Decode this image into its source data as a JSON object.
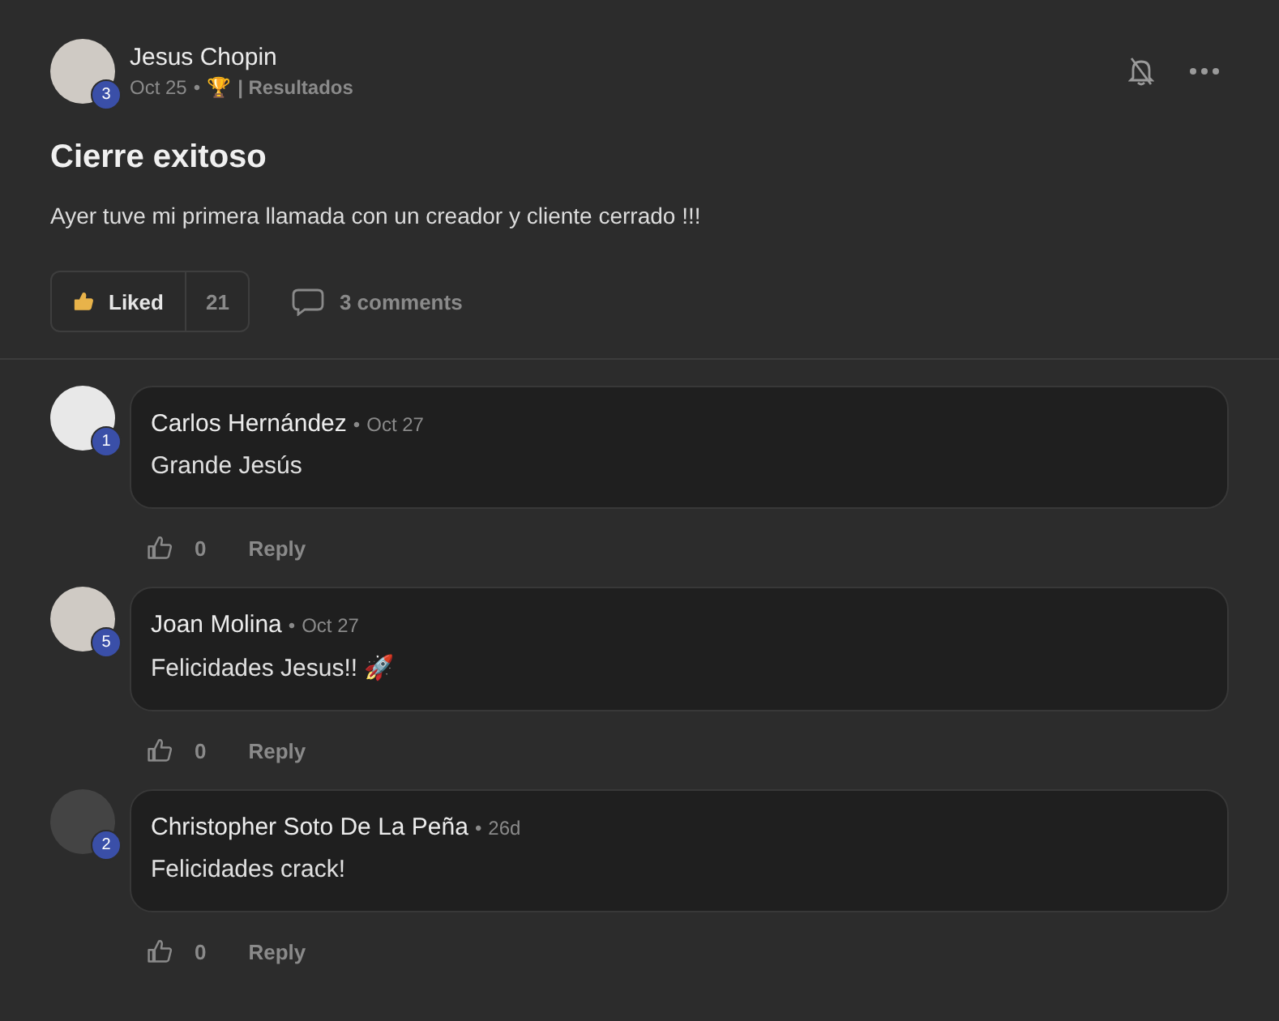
{
  "post": {
    "author": "Jesus Chopin",
    "level_badge": "3",
    "date": "Oct 25",
    "separator": "•",
    "trophy": "🏆",
    "category": "| Resultados",
    "title": "Cierre exitoso",
    "body": "Ayer tuve mi primera llamada con un creador y cliente cerrado !!!",
    "like": {
      "label": "Liked",
      "count": "21",
      "liked": true
    },
    "comments_label": "3 comments"
  },
  "comments": [
    {
      "author": "Carlos Hernández",
      "badge": "1",
      "separator": "•",
      "date": "Oct 27",
      "text": "Grande Jesús",
      "likes": "0",
      "reply": "Reply"
    },
    {
      "author": "Joan Molina",
      "badge": "5",
      "separator": "•",
      "date": "Oct 27",
      "text": "Felicidades Jesus!! 🚀",
      "likes": "0",
      "reply": "Reply"
    },
    {
      "author": "Christopher Soto De La Peña",
      "badge": "2",
      "separator": "•",
      "date": "26d",
      "text": "Felicidades crack!",
      "likes": "0",
      "reply": "Reply"
    }
  ]
}
